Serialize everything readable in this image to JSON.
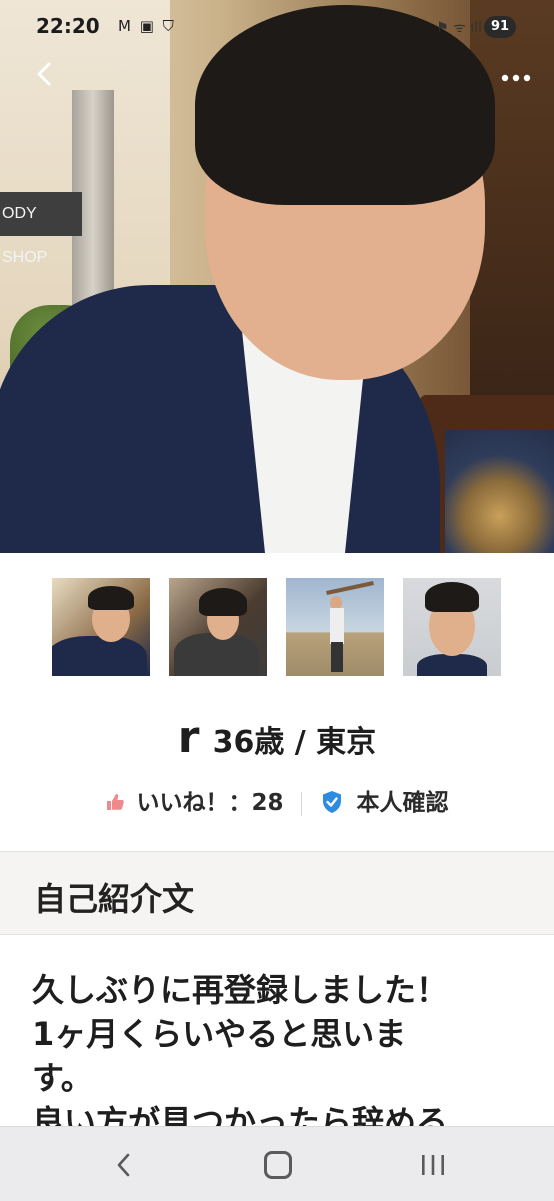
{
  "status_bar": {
    "time": "22:20",
    "left_icons": "M ▣ ⛉",
    "right_icons": "⚑ ᯤ ıll",
    "battery": "91"
  },
  "header": {
    "back_icon": "chevron-left-icon",
    "more_icon": "more-horizontal-icon"
  },
  "hero": {
    "store_sign_text": "ODY SHOP"
  },
  "profile": {
    "nickname": "r",
    "age_location": "36歳 / 東京",
    "likes_label": "いいね！：28",
    "verified_label": "本人確認"
  },
  "section": {
    "title": "自己紹介文"
  },
  "bio": {
    "text": "久しぶりに再登録しました！\n1ヶ月くらいやると思いま\nす。\n良い方が見つかったら辞める"
  },
  "nav": {
    "back": "‹",
    "home": "",
    "recent": "|||"
  }
}
